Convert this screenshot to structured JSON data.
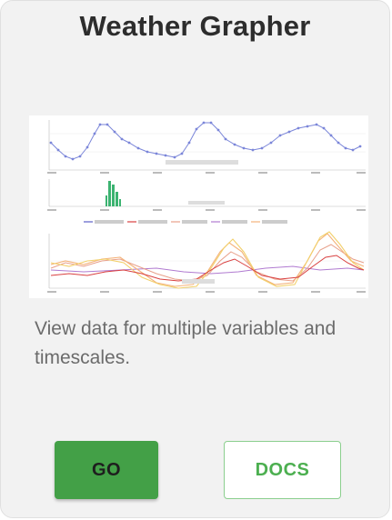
{
  "card": {
    "title": "Weather Grapher",
    "description": "View data for multiple variables and timescales.",
    "go_label": "GO",
    "docs_label": "DOCS"
  },
  "thumbnail": {
    "icon": "weather-graph-preview",
    "colors": {
      "line_blue": "#7b86d9",
      "bar_green": "#3cb371",
      "line_red": "#d94040",
      "line_orange": "#f4b27a",
      "line_yellow": "#f2d06b",
      "line_purple": "#b07ad0",
      "line_salmon": "#e8a08a"
    }
  },
  "colors": {
    "card_bg": "#f2f2f2",
    "title": "#2d2d2d",
    "text_muted": "#6b6b6b",
    "accent_green": "#43a047",
    "docs_text": "#4caf50"
  }
}
